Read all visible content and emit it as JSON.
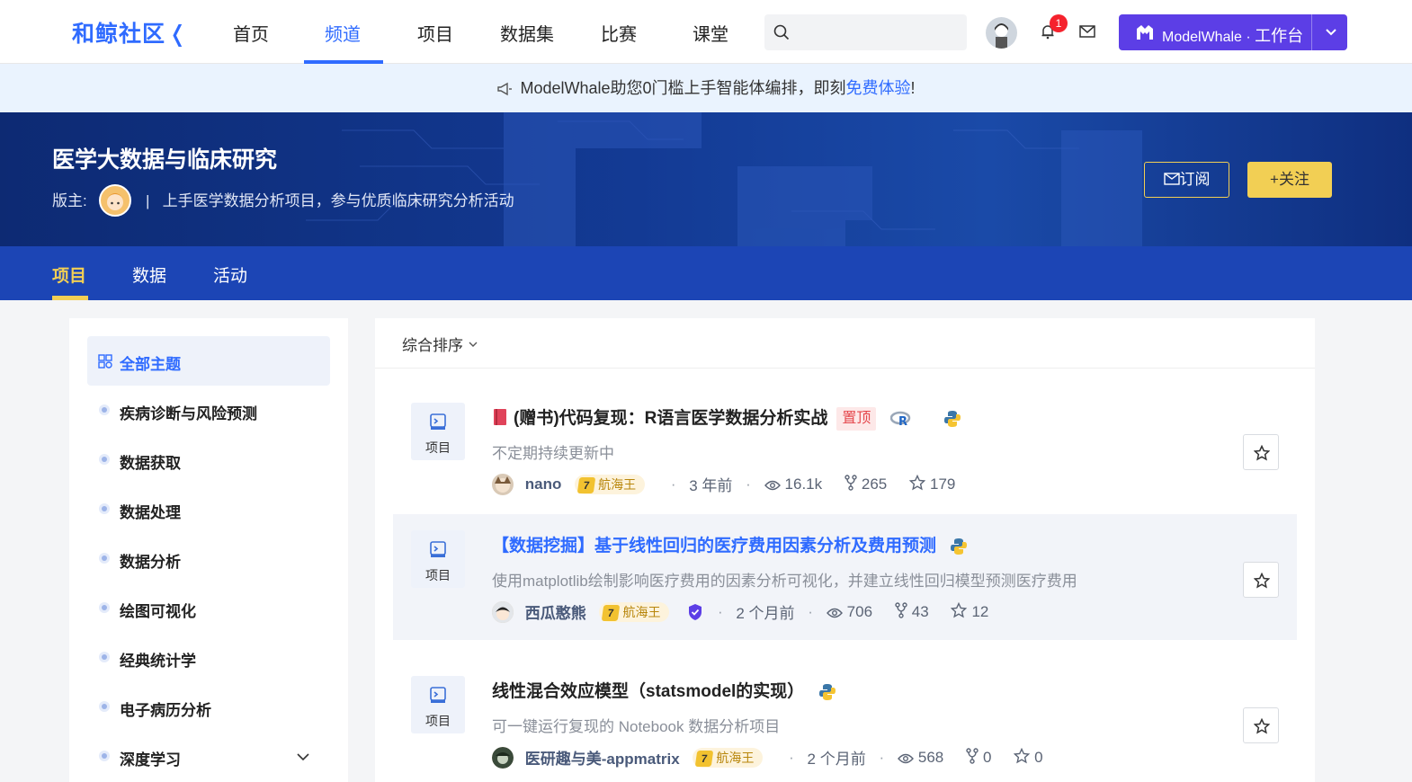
{
  "topnav": {
    "logo": "和鲸社区",
    "items": [
      "首页",
      "频道",
      "项目",
      "数据集",
      "比赛",
      "课堂"
    ],
    "active_index": 1,
    "search_placeholder": "",
    "notification_count": "1",
    "workbench": {
      "brand": "ModelWhale",
      "separator": "·",
      "label": "工作台"
    }
  },
  "announcement": {
    "text": "ModelWhale助您0门槛上手智能体编排，即刻",
    "link": "免费体验",
    "suffix": "!"
  },
  "channel": {
    "title": "医学大数据与临床研究",
    "moderator_label": "版主:",
    "separator": "|",
    "description": "上手医学数据分析项目，参与优质临床研究分析活动",
    "subscribe_label": "订阅",
    "follow_label": "+关注"
  },
  "channel_tabs": [
    "项目",
    "数据",
    "活动"
  ],
  "sidebar": {
    "items": [
      {
        "label": "全部主题",
        "active": true
      },
      {
        "label": "疾病诊断与风险预测"
      },
      {
        "label": "数据获取"
      },
      {
        "label": "数据处理"
      },
      {
        "label": "数据分析"
      },
      {
        "label": "绘图可视化"
      },
      {
        "label": "经典统计学"
      },
      {
        "label": "电子病历分析"
      },
      {
        "label": "深度学习",
        "expandable": true
      }
    ]
  },
  "sort": {
    "label": "综合排序"
  },
  "projects": [
    {
      "type_label": "项目",
      "title": "(赠书)代码复现：R语言医学数据分析实战",
      "pinned_label": "置顶",
      "langs": [
        "r-icon",
        "python-icon"
      ],
      "description": "不定期持续更新中",
      "author": "nano",
      "rank_level": "7",
      "rank_name": "航海王",
      "time": "3 年前",
      "views": "16.1k",
      "forks": "265",
      "stars": "179"
    },
    {
      "type_label": "项目",
      "title": "【数据挖掘】基于线性回归的医疗费用因素分析及费用预测",
      "langs": [
        "python-icon"
      ],
      "description": "使用matplotlib绘制影响医疗费用的因素分析可视化，并建立线性回归模型预测医疗费用",
      "author": "西瓜憨熊",
      "rank_level": "7",
      "rank_name": "航海王",
      "verified": true,
      "time": "2 个月前",
      "views": "706",
      "forks": "43",
      "stars": "12"
    },
    {
      "type_label": "项目",
      "title": "线性混合效应模型（statsmodel的实现）",
      "langs": [
        "python-icon"
      ],
      "description": "可一键运行复现的 Notebook 数据分析项目",
      "author": "医研趣与美-appmatrix",
      "rank_level": "7",
      "rank_name": "航海王",
      "time": "2 个月前",
      "views": "568",
      "forks": "0",
      "stars": "0"
    }
  ],
  "colors": {
    "accent": "#2f6bff",
    "banner": "#133a94",
    "gold": "#f2cf54",
    "workbench": "#5c3ee6"
  }
}
